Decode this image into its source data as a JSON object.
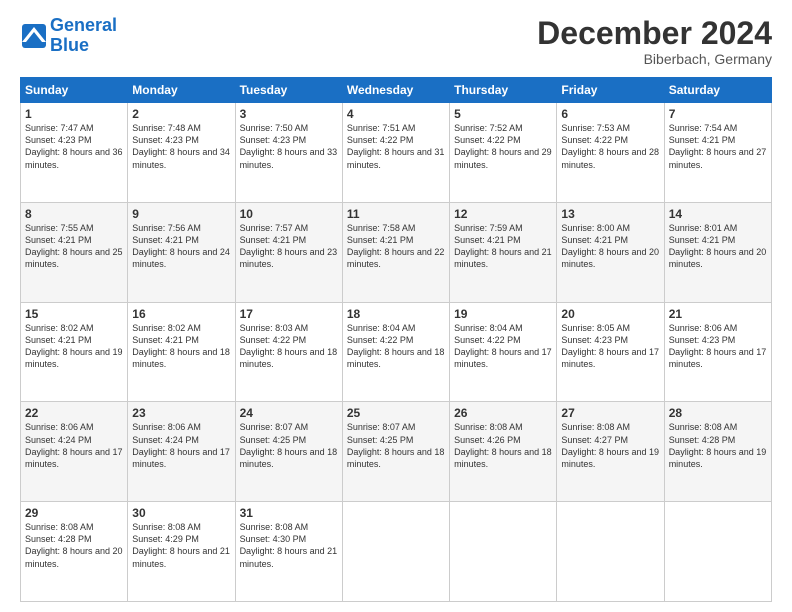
{
  "header": {
    "logo_line1": "General",
    "logo_line2": "Blue",
    "month": "December 2024",
    "location": "Biberbach, Germany"
  },
  "days_of_week": [
    "Sunday",
    "Monday",
    "Tuesday",
    "Wednesday",
    "Thursday",
    "Friday",
    "Saturday"
  ],
  "weeks": [
    [
      {
        "day": "1",
        "sunrise": "7:47 AM",
        "sunset": "4:23 PM",
        "daylight": "8 hours and 36 minutes."
      },
      {
        "day": "2",
        "sunrise": "7:48 AM",
        "sunset": "4:23 PM",
        "daylight": "8 hours and 34 minutes."
      },
      {
        "day": "3",
        "sunrise": "7:50 AM",
        "sunset": "4:23 PM",
        "daylight": "8 hours and 33 minutes."
      },
      {
        "day": "4",
        "sunrise": "7:51 AM",
        "sunset": "4:22 PM",
        "daylight": "8 hours and 31 minutes."
      },
      {
        "day": "5",
        "sunrise": "7:52 AM",
        "sunset": "4:22 PM",
        "daylight": "8 hours and 29 minutes."
      },
      {
        "day": "6",
        "sunrise": "7:53 AM",
        "sunset": "4:22 PM",
        "daylight": "8 hours and 28 minutes."
      },
      {
        "day": "7",
        "sunrise": "7:54 AM",
        "sunset": "4:21 PM",
        "daylight": "8 hours and 27 minutes."
      }
    ],
    [
      {
        "day": "8",
        "sunrise": "7:55 AM",
        "sunset": "4:21 PM",
        "daylight": "8 hours and 25 minutes."
      },
      {
        "day": "9",
        "sunrise": "7:56 AM",
        "sunset": "4:21 PM",
        "daylight": "8 hours and 24 minutes."
      },
      {
        "day": "10",
        "sunrise": "7:57 AM",
        "sunset": "4:21 PM",
        "daylight": "8 hours and 23 minutes."
      },
      {
        "day": "11",
        "sunrise": "7:58 AM",
        "sunset": "4:21 PM",
        "daylight": "8 hours and 22 minutes."
      },
      {
        "day": "12",
        "sunrise": "7:59 AM",
        "sunset": "4:21 PM",
        "daylight": "8 hours and 21 minutes."
      },
      {
        "day": "13",
        "sunrise": "8:00 AM",
        "sunset": "4:21 PM",
        "daylight": "8 hours and 20 minutes."
      },
      {
        "day": "14",
        "sunrise": "8:01 AM",
        "sunset": "4:21 PM",
        "daylight": "8 hours and 20 minutes."
      }
    ],
    [
      {
        "day": "15",
        "sunrise": "8:02 AM",
        "sunset": "4:21 PM",
        "daylight": "8 hours and 19 minutes."
      },
      {
        "day": "16",
        "sunrise": "8:02 AM",
        "sunset": "4:21 PM",
        "daylight": "8 hours and 18 minutes."
      },
      {
        "day": "17",
        "sunrise": "8:03 AM",
        "sunset": "4:22 PM",
        "daylight": "8 hours and 18 minutes."
      },
      {
        "day": "18",
        "sunrise": "8:04 AM",
        "sunset": "4:22 PM",
        "daylight": "8 hours and 18 minutes."
      },
      {
        "day": "19",
        "sunrise": "8:04 AM",
        "sunset": "4:22 PM",
        "daylight": "8 hours and 17 minutes."
      },
      {
        "day": "20",
        "sunrise": "8:05 AM",
        "sunset": "4:23 PM",
        "daylight": "8 hours and 17 minutes."
      },
      {
        "day": "21",
        "sunrise": "8:06 AM",
        "sunset": "4:23 PM",
        "daylight": "8 hours and 17 minutes."
      }
    ],
    [
      {
        "day": "22",
        "sunrise": "8:06 AM",
        "sunset": "4:24 PM",
        "daylight": "8 hours and 17 minutes."
      },
      {
        "day": "23",
        "sunrise": "8:06 AM",
        "sunset": "4:24 PM",
        "daylight": "8 hours and 17 minutes."
      },
      {
        "day": "24",
        "sunrise": "8:07 AM",
        "sunset": "4:25 PM",
        "daylight": "8 hours and 18 minutes."
      },
      {
        "day": "25",
        "sunrise": "8:07 AM",
        "sunset": "4:25 PM",
        "daylight": "8 hours and 18 minutes."
      },
      {
        "day": "26",
        "sunrise": "8:08 AM",
        "sunset": "4:26 PM",
        "daylight": "8 hours and 18 minutes."
      },
      {
        "day": "27",
        "sunrise": "8:08 AM",
        "sunset": "4:27 PM",
        "daylight": "8 hours and 19 minutes."
      },
      {
        "day": "28",
        "sunrise": "8:08 AM",
        "sunset": "4:28 PM",
        "daylight": "8 hours and 19 minutes."
      }
    ],
    [
      {
        "day": "29",
        "sunrise": "8:08 AM",
        "sunset": "4:28 PM",
        "daylight": "8 hours and 20 minutes."
      },
      {
        "day": "30",
        "sunrise": "8:08 AM",
        "sunset": "4:29 PM",
        "daylight": "8 hours and 21 minutes."
      },
      {
        "day": "31",
        "sunrise": "8:08 AM",
        "sunset": "4:30 PM",
        "daylight": "8 hours and 21 minutes."
      },
      null,
      null,
      null,
      null
    ]
  ]
}
